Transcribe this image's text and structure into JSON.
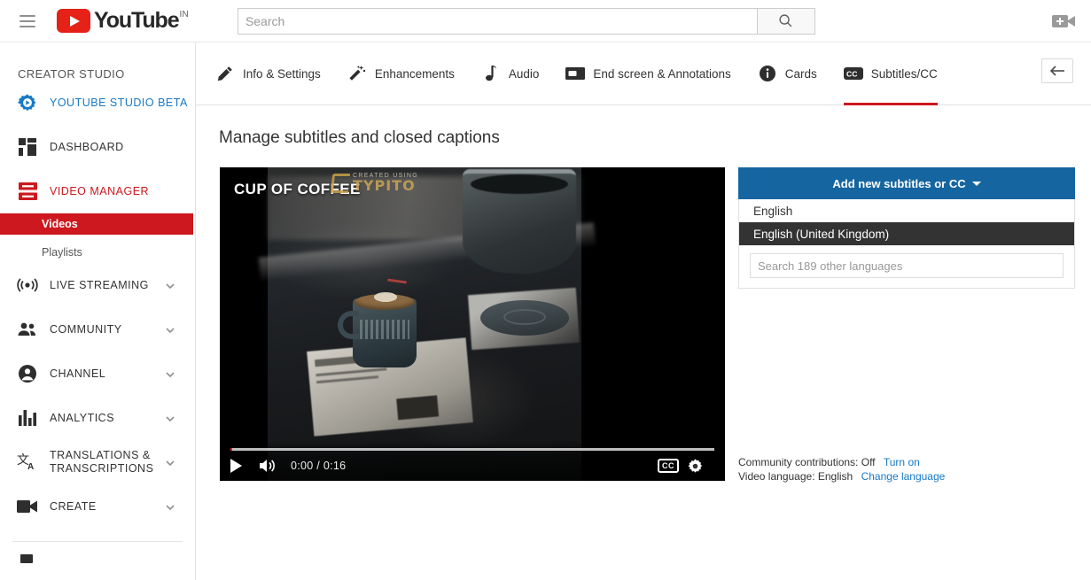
{
  "header": {
    "menu_icon": "hamburger-icon",
    "logo_text": "YouTube",
    "logo_country": "IN",
    "search_placeholder": "Search",
    "search_value": "",
    "search_icon": "search-icon",
    "upload_icon": "video-upload-icon"
  },
  "sidebar": {
    "title": "CREATOR STUDIO",
    "items": [
      {
        "label": "YOUTUBE STUDIO BETA",
        "icon": "studio-beta-gear-icon",
        "style": "blue",
        "chevron": false
      },
      {
        "label": "DASHBOARD",
        "icon": "dashboard-grid-icon",
        "style": "default",
        "chevron": false
      },
      {
        "label": "VIDEO MANAGER",
        "icon": "video-manager-icon",
        "style": "red",
        "chevron": false
      },
      {
        "label": "LIVE STREAMING",
        "icon": "live-broadcast-icon",
        "style": "default",
        "chevron": true
      },
      {
        "label": "COMMUNITY",
        "icon": "community-people-icon",
        "style": "default",
        "chevron": true
      },
      {
        "label": "CHANNEL",
        "icon": "channel-person-icon",
        "style": "default",
        "chevron": true
      },
      {
        "label": "ANALYTICS",
        "icon": "analytics-bars-icon",
        "style": "default",
        "chevron": true
      },
      {
        "label": "TRANSLATIONS & TRANSCRIPTIONS",
        "icon": "translate-icon",
        "style": "default",
        "chevron": true
      },
      {
        "label": "CREATE",
        "icon": "create-camera-icon",
        "style": "default",
        "chevron": true
      }
    ],
    "subitems": [
      {
        "label": "Videos",
        "active": true
      },
      {
        "label": "Playlists",
        "active": false
      }
    ]
  },
  "tabs": [
    {
      "label": "Info & Settings",
      "icon": "pencil-icon",
      "active": false
    },
    {
      "label": "Enhancements",
      "icon": "magic-wand-icon",
      "active": false
    },
    {
      "label": "Audio",
      "icon": "music-note-icon",
      "active": false
    },
    {
      "label": "End screen & Annotations",
      "icon": "end-screen-icon",
      "active": false
    },
    {
      "label": "Cards",
      "icon": "info-circle-icon",
      "active": false
    },
    {
      "label": "Subtitles/CC",
      "icon": "cc-icon",
      "active": true
    }
  ],
  "back_button_icon": "back-arrow-icon",
  "main": {
    "page_title": "Manage subtitles and closed captions"
  },
  "player": {
    "video_title_overlay": "CUP OF COFFEE",
    "watermark_small": "CREATED USING",
    "watermark_big": "TYPITO",
    "current_time": "0:00",
    "duration": "0:16",
    "time_display": "0:00 / 0:16",
    "play_icon": "play-icon",
    "volume_icon": "volume-icon",
    "cc_label": "CC",
    "settings_icon": "gear-icon"
  },
  "subtitles_panel": {
    "add_button_label": "Add new subtitles or CC",
    "languages": [
      {
        "label": "English",
        "highlighted": false
      },
      {
        "label": "English (United Kingdom)",
        "highlighted": true
      }
    ],
    "search_placeholder": "Search 189 other languages",
    "search_value": "",
    "community_label": "Community contributions:",
    "community_value": "Off",
    "community_action": "Turn on",
    "video_language_label": "Video language:",
    "video_language_value": "English",
    "video_language_action": "Change language"
  },
  "colors": {
    "brand_red": "#cc181e",
    "link_blue": "#167ac6",
    "dropdown_blue": "#1565a0",
    "highlight_dark": "#333333"
  }
}
